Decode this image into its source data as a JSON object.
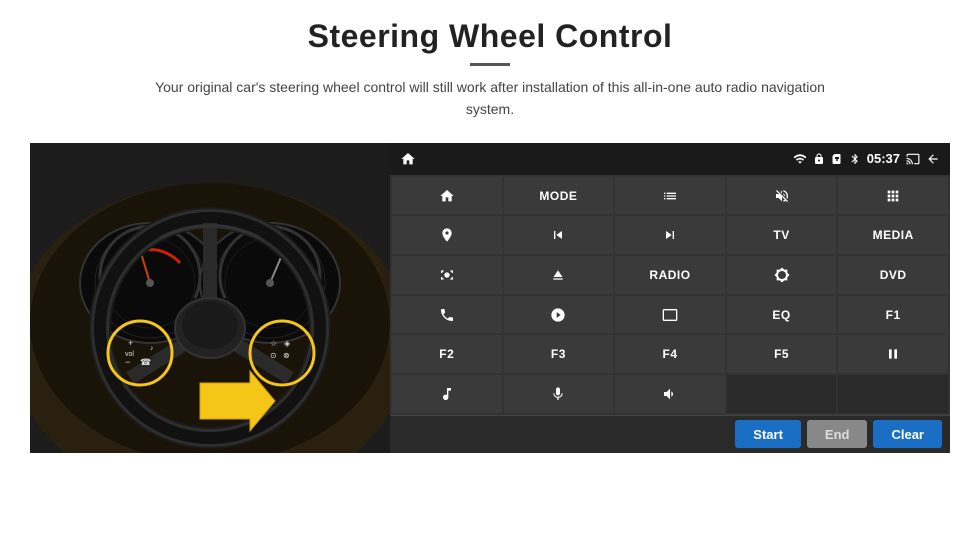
{
  "header": {
    "title": "Steering Wheel Control",
    "subtitle": "Your original car's steering wheel control will still work after installation of this all-in-one auto radio navigation system."
  },
  "statusBar": {
    "time": "05:37",
    "icons": [
      "wifi",
      "lock",
      "sim",
      "bluetooth",
      "cast",
      "back"
    ]
  },
  "buttonGrid": [
    {
      "id": "home",
      "type": "icon",
      "icon": "home"
    },
    {
      "id": "mode",
      "type": "text",
      "label": "MODE"
    },
    {
      "id": "list",
      "type": "icon",
      "icon": "list"
    },
    {
      "id": "mute",
      "type": "icon",
      "icon": "mute"
    },
    {
      "id": "apps",
      "type": "icon",
      "icon": "apps"
    },
    {
      "id": "nav",
      "type": "icon",
      "icon": "nav"
    },
    {
      "id": "prev",
      "type": "icon",
      "icon": "prev"
    },
    {
      "id": "next",
      "type": "icon",
      "icon": "next"
    },
    {
      "id": "tv",
      "type": "text",
      "label": "TV"
    },
    {
      "id": "media",
      "type": "text",
      "label": "MEDIA"
    },
    {
      "id": "cam360",
      "type": "icon",
      "icon": "cam360"
    },
    {
      "id": "eject",
      "type": "icon",
      "icon": "eject"
    },
    {
      "id": "radio",
      "type": "text",
      "label": "RADIO"
    },
    {
      "id": "brightness",
      "type": "icon",
      "icon": "brightness"
    },
    {
      "id": "dvd",
      "type": "text",
      "label": "DVD"
    },
    {
      "id": "phone",
      "type": "icon",
      "icon": "phone"
    },
    {
      "id": "nav2",
      "type": "icon",
      "icon": "nav2"
    },
    {
      "id": "screen",
      "type": "icon",
      "icon": "screen"
    },
    {
      "id": "eq",
      "type": "text",
      "label": "EQ"
    },
    {
      "id": "f1",
      "type": "text",
      "label": "F1"
    },
    {
      "id": "f2",
      "type": "text",
      "label": "F2"
    },
    {
      "id": "f3",
      "type": "text",
      "label": "F3"
    },
    {
      "id": "f4",
      "type": "text",
      "label": "F4"
    },
    {
      "id": "f5",
      "type": "text",
      "label": "F5"
    },
    {
      "id": "playpause",
      "type": "icon",
      "icon": "playpause"
    },
    {
      "id": "music",
      "type": "icon",
      "icon": "music"
    },
    {
      "id": "mic",
      "type": "icon",
      "icon": "mic"
    },
    {
      "id": "volphone",
      "type": "icon",
      "icon": "volphone"
    },
    {
      "id": "empty1",
      "type": "empty",
      "label": ""
    },
    {
      "id": "empty2",
      "type": "empty",
      "label": ""
    }
  ],
  "actionBar": {
    "startLabel": "Start",
    "endLabel": "End",
    "clearLabel": "Clear"
  }
}
